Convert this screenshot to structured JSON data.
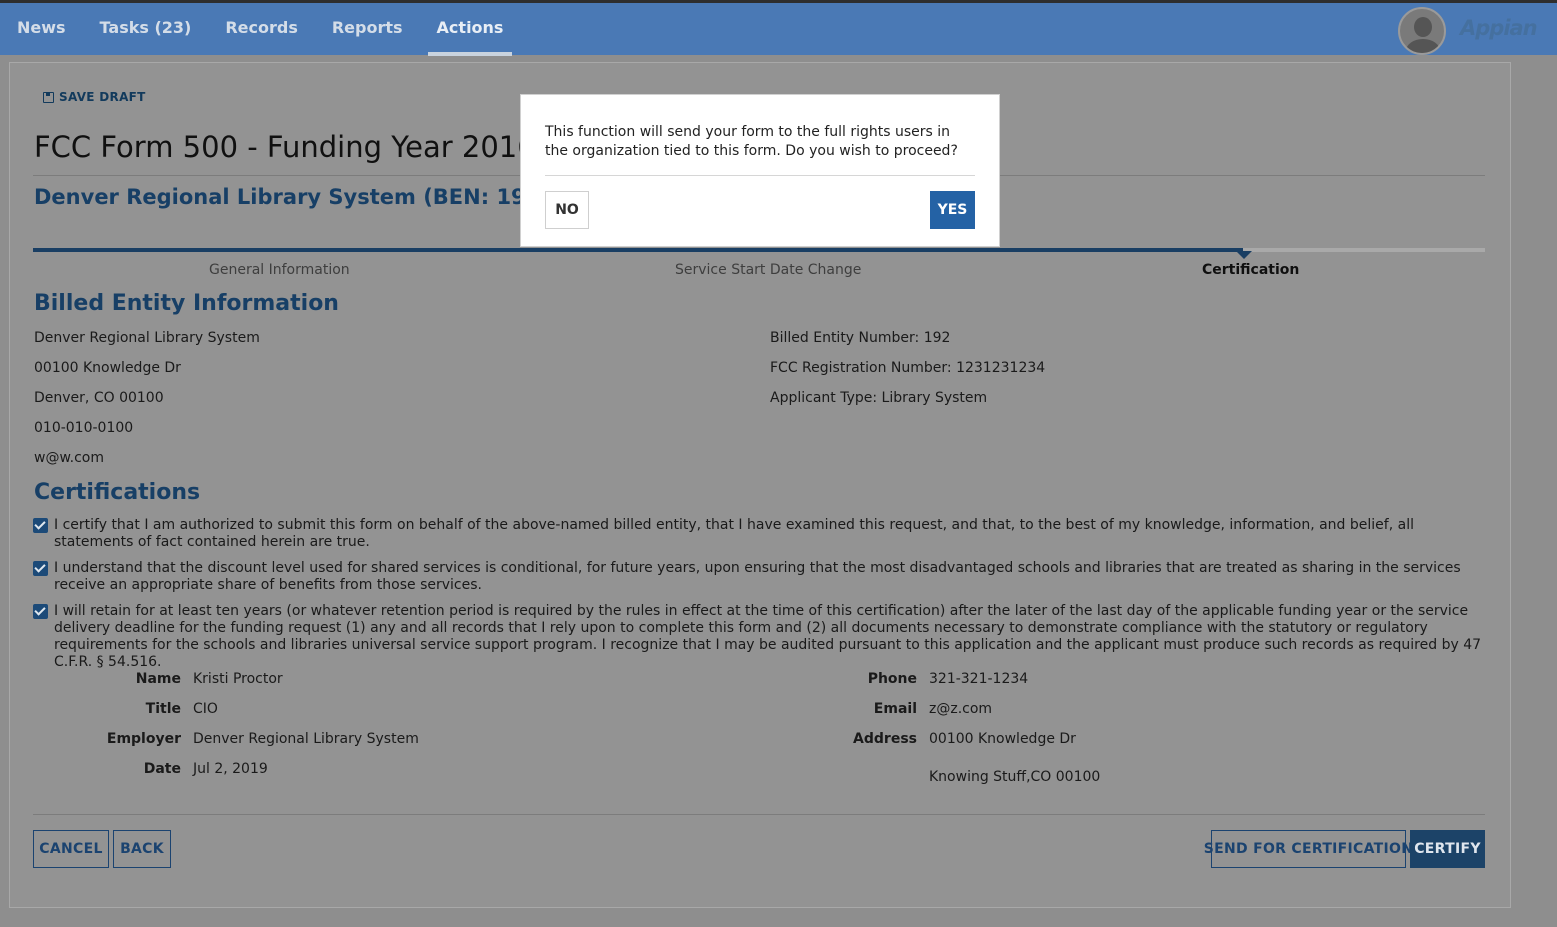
{
  "nav": {
    "items": [
      {
        "label": "News"
      },
      {
        "label": "Tasks (23)"
      },
      {
        "label": "Records"
      },
      {
        "label": "Reports"
      },
      {
        "label": "Actions",
        "active": true
      }
    ],
    "brand": "Appian"
  },
  "form": {
    "save_draft": "SAVE DRAFT",
    "title": "FCC Form 500 - Funding Year 2016",
    "subtitle": "Denver Regional Library System (BEN: 192) - T"
  },
  "steps": [
    {
      "label": "General Information"
    },
    {
      "label": "Service Start Date Change"
    },
    {
      "label": "Certification",
      "current": true
    }
  ],
  "billed_entity": {
    "heading": "Billed Entity Information",
    "left": [
      "Denver Regional Library System",
      "00100 Knowledge Dr",
      "Denver, CO 00100",
      "010-010-0100",
      "w@w.com"
    ],
    "right": [
      "Billed Entity Number: 192",
      "FCC Registration Number: 1231231234",
      "Applicant Type: Library System"
    ]
  },
  "certifications": {
    "heading": "Certifications",
    "items": [
      {
        "checked": true,
        "text": "I certify that I am authorized to submit this form on behalf of the above-named billed entity, that I have examined this request, and that, to the best of my knowledge, information, and belief, all statements of fact contained herein are true."
      },
      {
        "checked": true,
        "text": "I understand that the discount level used for shared services is conditional, for future years, upon ensuring that the most disadvantaged schools and libraries that are treated as sharing in the services receive an appropriate share of benefits from those services."
      },
      {
        "checked": true,
        "text": "I will retain for at least ten years (or whatever retention period is required by the rules in effect at the time of this certification) after the later of the last day of the applicable funding year or the service delivery deadline for the funding request (1) any and all records that I rely upon to complete this form and (2) all documents necessary to demonstrate compliance with the statutory or regulatory requirements for the schools and libraries universal service support program. I recognize that I may be audited pursuant to this application and the applicant must produce such records as required by 47 C.F.R. § 54.516."
      }
    ]
  },
  "certifier": {
    "name_label": "Name",
    "name": "Kristi Proctor",
    "title_label": "Title",
    "title": "CIO",
    "employer_label": "Employer",
    "employer": "Denver Regional Library System",
    "date_label": "Date",
    "date": "Jul 2, 2019",
    "phone_label": "Phone",
    "phone": "321-321-1234",
    "email_label": "Email",
    "email": "z@z.com",
    "address_label": "Address",
    "address_line1": "00100 Knowledge Dr",
    "address_line2": "Knowing Stuff,CO 00100"
  },
  "buttons": {
    "cancel": "CANCEL",
    "back": "BACK",
    "send": "SEND FOR CERTIFICATION",
    "certify": "CERTIFY"
  },
  "modal": {
    "message": "This function will send your form to the full rights users in the organization tied to this form. Do you wish to proceed?",
    "no": "NO",
    "yes": "YES"
  }
}
